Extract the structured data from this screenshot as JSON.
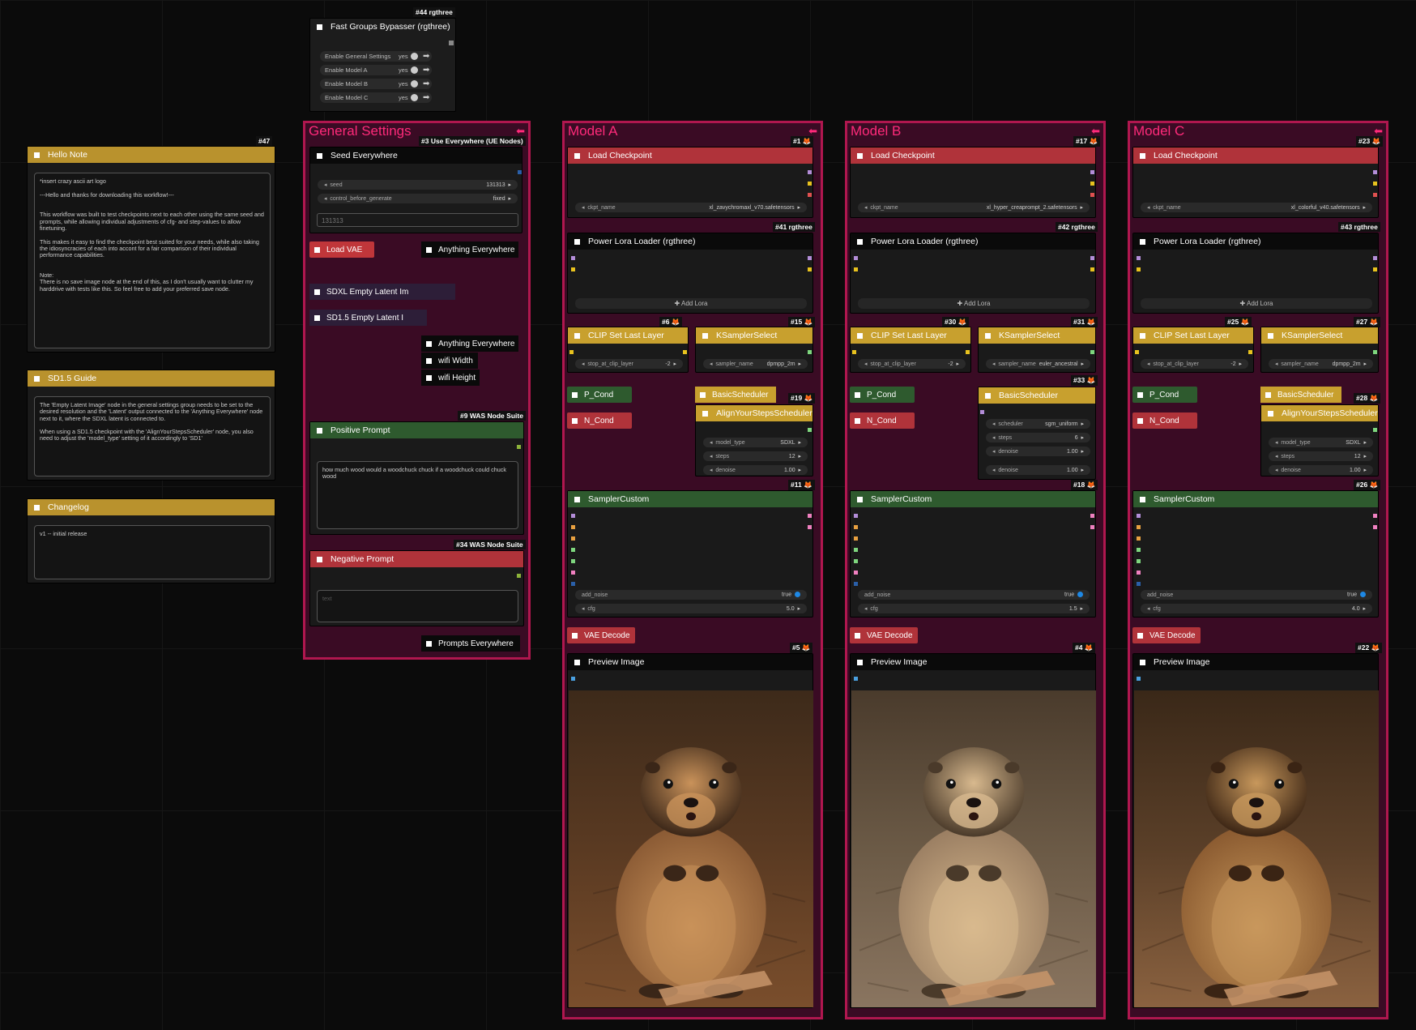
{
  "colors": {
    "group_border": "#b0174f",
    "group_fill": "#3a0b24",
    "group_title": "#ff2a7a",
    "accent_blue": "#1e88e5"
  },
  "bypasser": {
    "badge": "#44 rgthree",
    "title": "Fast Groups Bypasser (rgthree)",
    "rows": [
      {
        "label": "Enable General Settings",
        "value": "yes"
      },
      {
        "label": "Enable Model A",
        "value": "yes"
      },
      {
        "label": "Enable Model B",
        "value": "yes"
      },
      {
        "label": "Enable Model C",
        "value": "yes"
      }
    ]
  },
  "notes": {
    "hello": {
      "badge": "#47",
      "title": "Hello Note",
      "text": "*insert crazy ascii art logo\n\n---Hello and thanks for downloading this workflow!---\n\n\nThis workflow was built to test checkpoints next to each other using the same seed and prompts, while allowing individual adjustments of cfg- and step-values to allow finetuning.\n\nThis makes it easy to find the checkpoint best suited for your needs, while also taking the idiosyncracies of each into accont for a fair comparison of their individual performance capabilities.\n\n\nNote:\nThere is no save image node at the end of this, as I don't usually want to clutter my harddrive with tests like this. So feel free to add your preferred save node."
    },
    "guide": {
      "title": "SD1.5 Guide",
      "text": "The 'Empty Latent Image' node in the general settings group needs to be set to the desired resolution and the 'Latent' output connected to the 'Anything Everywhere' node next to it, where the SDXL latent is connected to.\n\nWhen using a SD1.5 checkpoint with the 'AlignYourStepsScheduler' node, you also need to adjust the 'model_type' setting of it accordingly to 'SD1'"
    },
    "changelog": {
      "title": "Changelog",
      "text": "v1 -- initial release"
    }
  },
  "general": {
    "title": "General Settings",
    "seed_node": {
      "badge": "#3 Use Everywhere (UE Nodes)",
      "title": "Seed Everywhere",
      "seed_label": "seed",
      "seed_value": "131313",
      "cbg_label": "control_before_generate",
      "cbg_value": "fixed",
      "input_value": "131313"
    },
    "load_vae": "Load VAE",
    "anything1": "Anything Everywhere",
    "sdxl_latent": "SDXL Empty Latent Im",
    "sd15_latent": "SD1.5 Empty Latent I",
    "anything2": "Anything Everywhere",
    "width": "wifi Width",
    "height": "wifi Height",
    "positive": {
      "badge": "#9 WAS Node Suite",
      "title": "Positive Prompt",
      "text": "how much wood would a woodchuck chuck if a woodchuck could chuck wood"
    },
    "negative": {
      "badge": "#34 WAS Node Suite",
      "title": "Negative Prompt",
      "placeholder": "text"
    },
    "prompts_everywhere": "Prompts Everywhere"
  },
  "models": [
    {
      "title": "Model A",
      "ckpt_badge": "#1",
      "ckpt_name": "xl_zavychromaxl_v70.safetensors",
      "lora_badge": "#41 rgthree",
      "clip_badge": "#6",
      "ks_badge": "#15",
      "sched_badge": "#19",
      "scheduler_node": "AlignYourStepsScheduler",
      "model_type": "SDXL",
      "steps": "12",
      "denoise": "1.00",
      "sampler_name": "dpmpp_2m",
      "sc_badge": "#11",
      "cfg": "5.0",
      "dec_badge": "#5"
    },
    {
      "title": "Model B",
      "ckpt_badge": "#17",
      "ckpt_name": "xl_hyper_creaprompt_2.safetensors",
      "lora_badge": "#42 rgthree",
      "clip_badge": "#30",
      "ks_badge": "#31",
      "sched_badge": "#33",
      "scheduler_node": "BasicScheduler",
      "scheduler": "sgm_uniform",
      "steps": "6",
      "denoise": "1.00",
      "denoise2": "1.00",
      "sampler_name": "euler_ancestral",
      "sc_badge": "#18",
      "cfg": "1.5",
      "dec_badge": "#4"
    },
    {
      "title": "Model C",
      "ckpt_badge": "#23",
      "ckpt_name": "xl_colorful_v40.safetensors",
      "lora_badge": "#43 rgthree",
      "clip_badge": "#25",
      "ks_badge": "#27",
      "sched_badge": "#28",
      "scheduler_node": "AlignYourStepsScheduler",
      "model_type": "SDXL",
      "steps": "12",
      "denoise": "1.00",
      "sampler_name": "dpmpp_2m",
      "sc_badge": "#26",
      "cfg": "4.0",
      "dec_badge": "#22"
    }
  ],
  "labels": {
    "load_checkpoint": "Load Checkpoint",
    "ckpt_name": "ckpt_name",
    "power_lora": "Power Lora Loader (rgthree)",
    "add_lora": "Add Lora",
    "clip_set": "CLIP Set Last Layer",
    "stop_at": "stop_at_clip_layer",
    "stop_val": "-2",
    "ksampler_select": "KSamplerSelect",
    "sampler_name": "sampler_name",
    "p_cond": "P_Cond",
    "n_cond": "N_Cond",
    "basic_scheduler": "BasicScheduler",
    "align": "AlignYourStepsScheduler",
    "model_type": "model_type",
    "steps": "steps",
    "denoise": "denoise",
    "scheduler": "scheduler",
    "sampler_custom": "SamplerCustom",
    "add_noise": "add_noise",
    "add_noise_val": "true",
    "cfg": "cfg",
    "vae_decode": "VAE Decode",
    "preview": "Preview Image"
  }
}
